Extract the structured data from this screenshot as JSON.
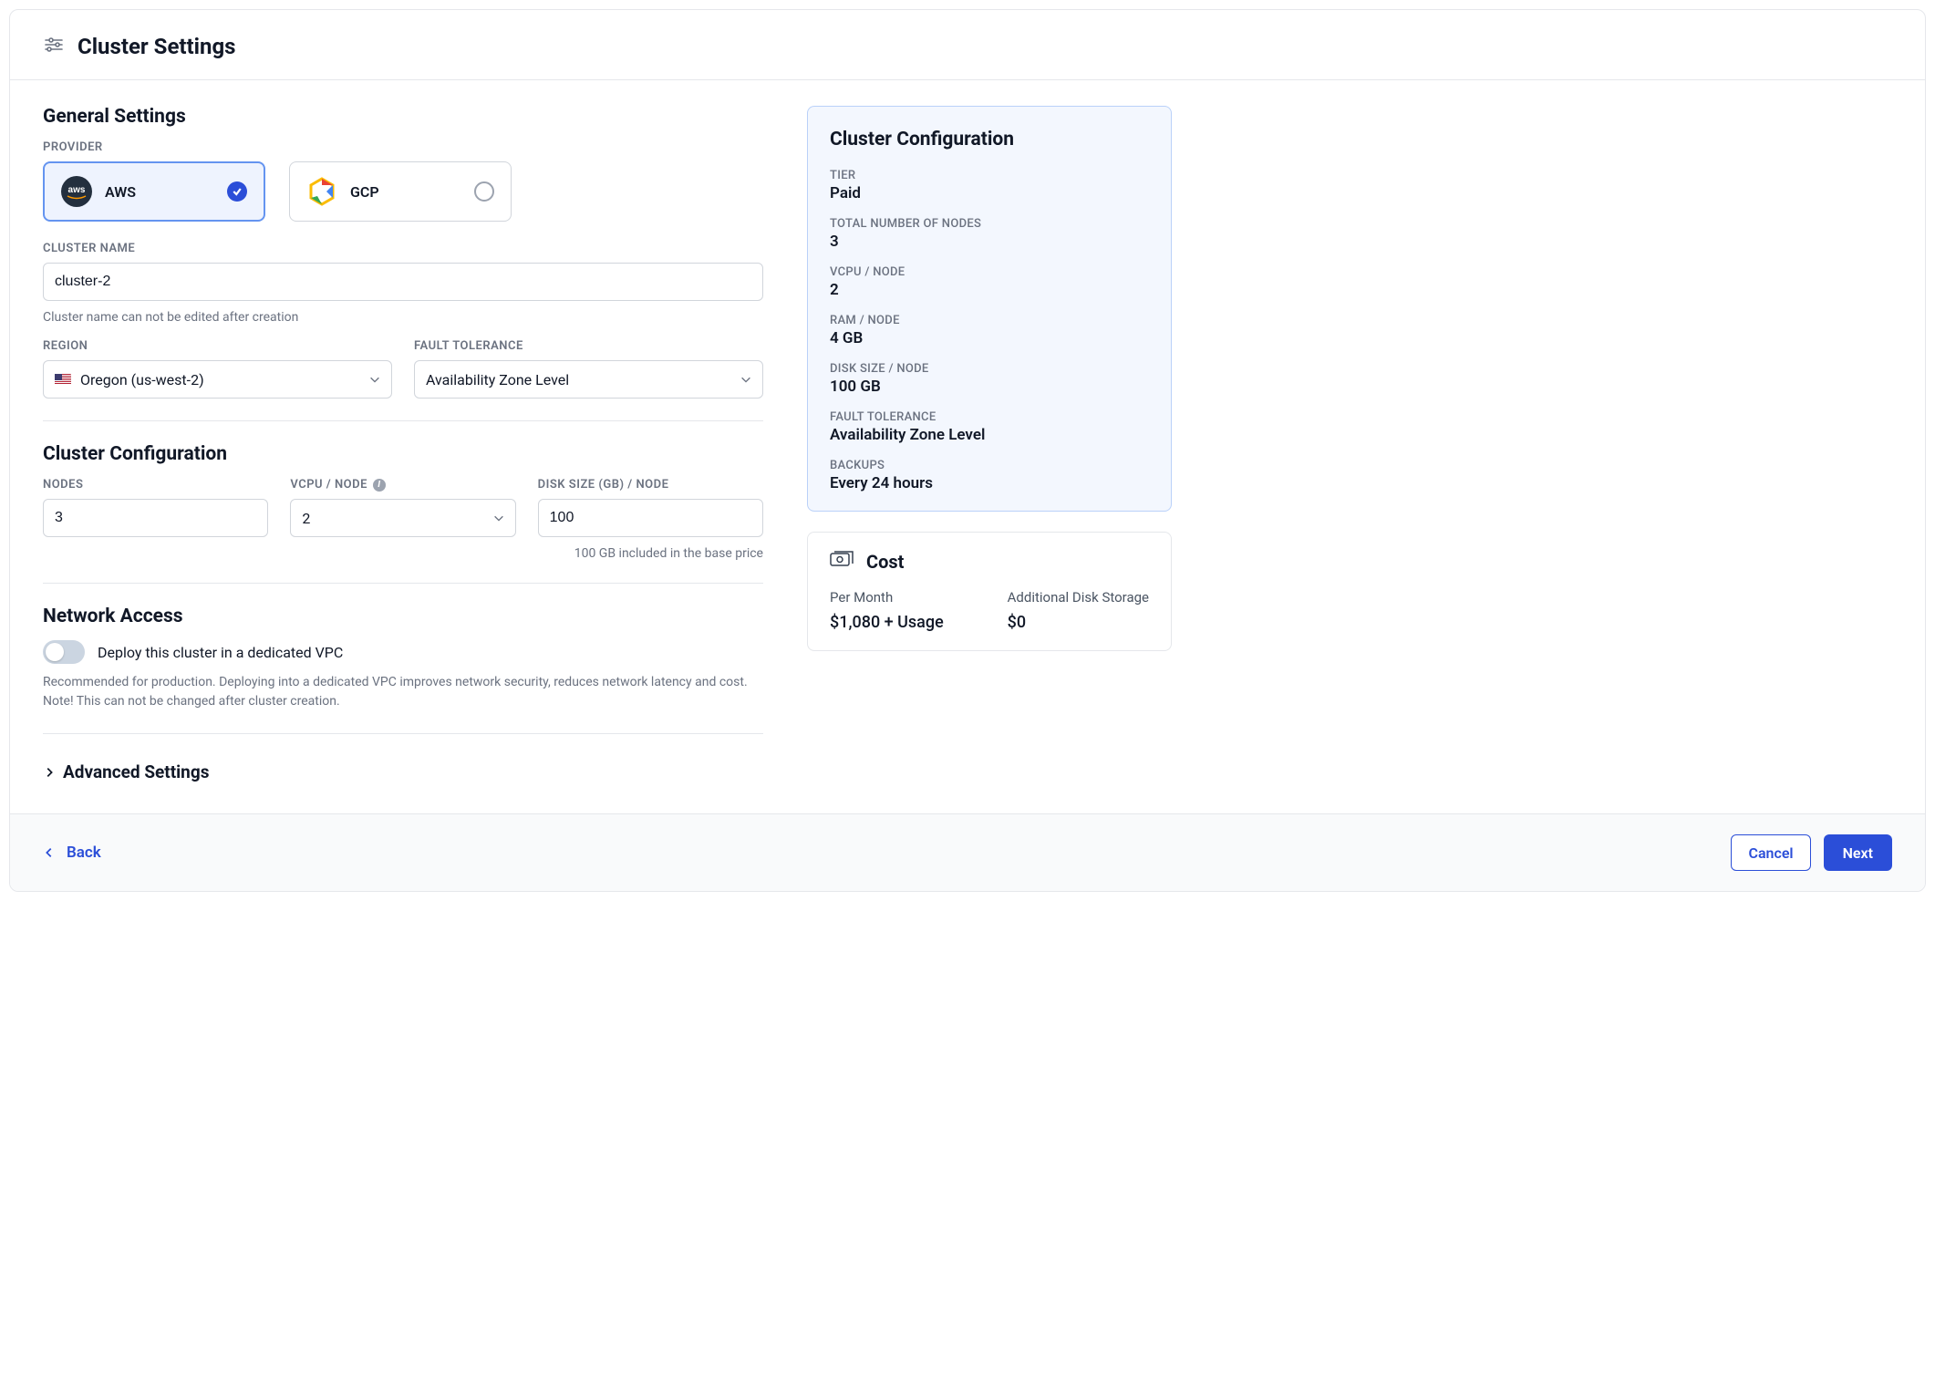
{
  "header": {
    "title": "Cluster Settings"
  },
  "general": {
    "title": "General Settings",
    "provider_label": "Provider",
    "providers": {
      "aws": "AWS",
      "gcp": "GCP"
    },
    "cluster_name_label": "Cluster Name",
    "cluster_name_value": "cluster-2",
    "cluster_name_hint": "Cluster name can not be edited after creation",
    "region_label": "Region",
    "region_value": "Oregon (us-west-2)",
    "fault_label": "Fault Tolerance",
    "fault_value": "Availability Zone Level"
  },
  "config": {
    "title": "Cluster Configuration",
    "nodes_label": "Nodes",
    "nodes_value": "3",
    "vcpu_label": "vCPU / Node",
    "vcpu_value": "2",
    "disk_label": "Disk Size (GB) / Node",
    "disk_value": "100",
    "disk_hint": "100 GB included in the base price"
  },
  "network": {
    "title": "Network Access",
    "toggle_label": "Deploy this cluster in a dedicated VPC",
    "desc": "Recommended for production. Deploying into a dedicated VPC improves network security, reduces network latency and cost. Note! This can not be changed after cluster creation."
  },
  "advanced": {
    "title": "Advanced Settings"
  },
  "summary": {
    "title": "Cluster Configuration",
    "tier_k": "Tier",
    "tier_v": "Paid",
    "nodes_k": "Total Number of Nodes",
    "nodes_v": "3",
    "vcpu_k": "vCPU / Node",
    "vcpu_v": "2",
    "ram_k": "RAM / Node",
    "ram_v": "4 GB",
    "disk_k": "Disk Size / Node",
    "disk_v": "100 GB",
    "fault_k": "Fault Tolerance",
    "fault_v": "Availability Zone Level",
    "backup_k": "Backups",
    "backup_v": "Every 24 hours"
  },
  "cost": {
    "title": "Cost",
    "per_month_k": "Per Month",
    "per_month_v": "$1,080 + Usage",
    "disk_k": "Additional Disk Storage",
    "disk_v": "$0"
  },
  "footer": {
    "back": "Back",
    "cancel": "Cancel",
    "next": "Next"
  }
}
